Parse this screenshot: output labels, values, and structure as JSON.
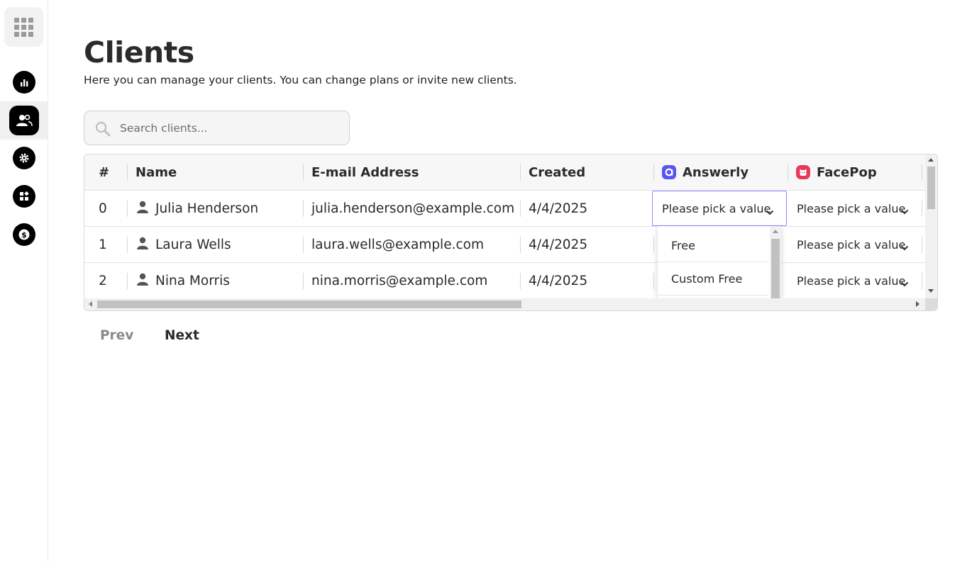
{
  "page": {
    "title": "Clients",
    "subtitle": "Here you can manage your clients. You can change plans or invite new clients."
  },
  "sidebar": {
    "items": [
      {
        "name": "analytics",
        "icon": "bar-chart-icon"
      },
      {
        "name": "clients",
        "icon": "users-icon",
        "active": true
      },
      {
        "name": "settings",
        "icon": "gear-icon"
      },
      {
        "name": "apps",
        "icon": "widgets-icon"
      },
      {
        "name": "billing",
        "icon": "dollar-icon"
      }
    ]
  },
  "search": {
    "placeholder": "Search clients..."
  },
  "table": {
    "headers": {
      "num": "#",
      "name": "Name",
      "email": "E-mail Address",
      "created": "Created",
      "answerly": "Answerly",
      "facepop": "FacePop"
    },
    "rows": [
      {
        "num": "0",
        "name": "Julia Henderson",
        "email": "julia.henderson@example.com",
        "created": "4/4/2025",
        "answerly": "Please pick a value",
        "facepop": "Please pick a value"
      },
      {
        "num": "1",
        "name": "Laura Wells",
        "email": "laura.wells@example.com",
        "created": "4/4/2025",
        "answerly": "",
        "facepop": "Please pick a value"
      },
      {
        "num": "2",
        "name": "Nina Morris",
        "email": "nina.morris@example.com",
        "created": "4/4/2025",
        "answerly": "",
        "facepop": "Please pick a value"
      }
    ]
  },
  "dropdown": {
    "options": [
      "Free",
      "Custom Free"
    ]
  },
  "pager": {
    "prev": "Prev",
    "next": "Next"
  },
  "colors": {
    "answerly": "#5b55f0",
    "facepop": "#e8365d",
    "focus": "#8d86ff"
  }
}
